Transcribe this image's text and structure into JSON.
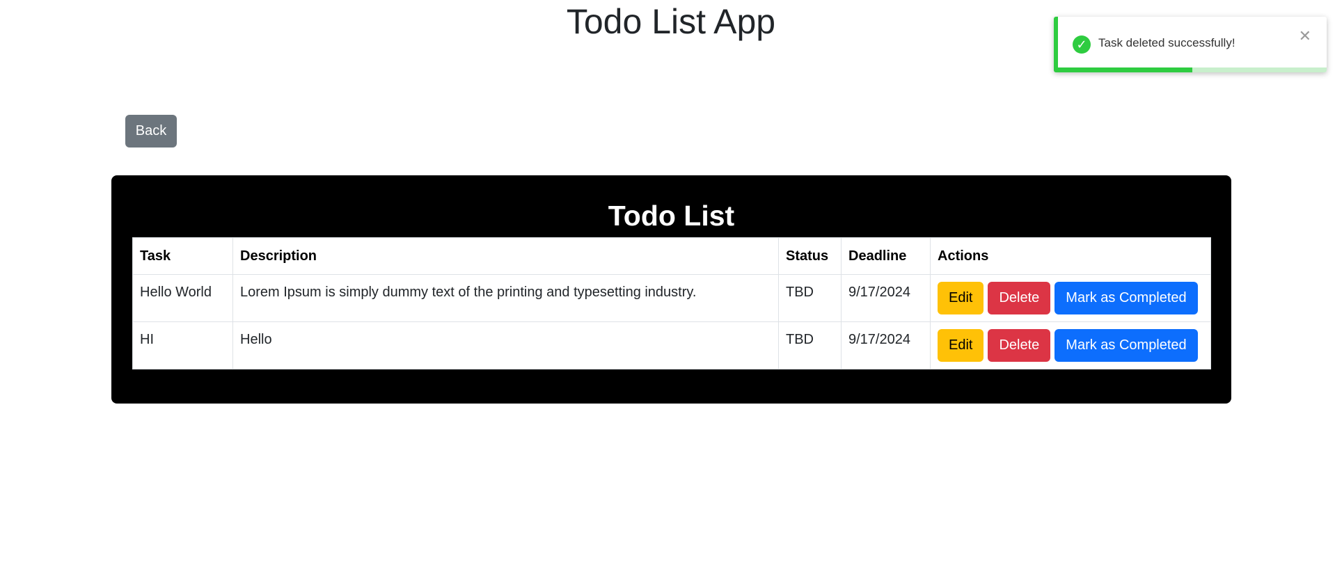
{
  "app": {
    "title": "Todo List App"
  },
  "nav": {
    "back_label": "Back"
  },
  "todo": {
    "title": "Todo List",
    "columns": [
      "Task",
      "Description",
      "Status",
      "Deadline",
      "Actions"
    ],
    "rows": [
      {
        "task": "Hello World",
        "description": "Lorem Ipsum is simply dummy text of the printing and typesetting industry.",
        "status": "TBD",
        "deadline": "9/17/2024",
        "edit_label": "Edit",
        "delete_label": "Delete",
        "complete_label": "Mark as Completed"
      },
      {
        "task": "HI",
        "description": "Hello",
        "status": "TBD",
        "deadline": "9/17/2024",
        "edit_label": "Edit",
        "delete_label": "Delete",
        "complete_label": "Mark as Completed"
      }
    ]
  },
  "toast": {
    "message": "Task deleted successfully!",
    "icon": "check-circle-icon",
    "close_icon": "close-icon",
    "progress": 0.5,
    "accent_color": "#2ecc40"
  },
  "colors": {
    "edit": "#ffc107",
    "delete": "#dc3545",
    "complete": "#0d6efd",
    "back": "#6c757d",
    "panel": "#000000"
  }
}
